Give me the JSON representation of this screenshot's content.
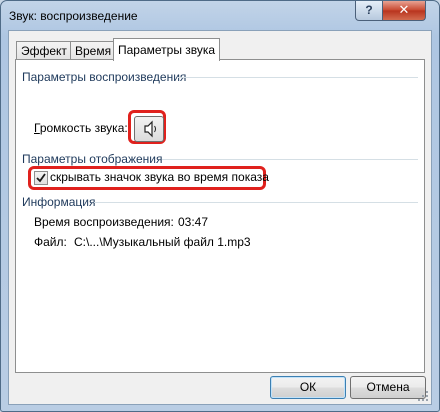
{
  "window": {
    "title": "Звук: воспроизведение",
    "help_label": "?",
    "close_label": "✕"
  },
  "tabs": [
    {
      "label": "Эффект",
      "active": false
    },
    {
      "label": "Время",
      "active": false
    },
    {
      "label": "Параметры звука",
      "active": true
    }
  ],
  "playback": {
    "section_title": "Параметры воспроизведения",
    "volume_label": "Громкость звука:",
    "volume_icon": "speaker-icon"
  },
  "display": {
    "section_title": "Параметры отображения",
    "hide_icon_label": "скрывать значок звука во время показа",
    "hide_icon_checked": true
  },
  "info": {
    "section_title": "Информация",
    "duration_label": "Время воспроизведения:",
    "duration_value": "03:47",
    "file_label": "Файл:",
    "file_value": "C:\\...\\Музыкальный файл 1.mp3"
  },
  "buttons": {
    "ok": "ОК",
    "cancel": "Отмена"
  },
  "colors": {
    "highlight": "#e0211d",
    "title_text": "#1e395b"
  }
}
